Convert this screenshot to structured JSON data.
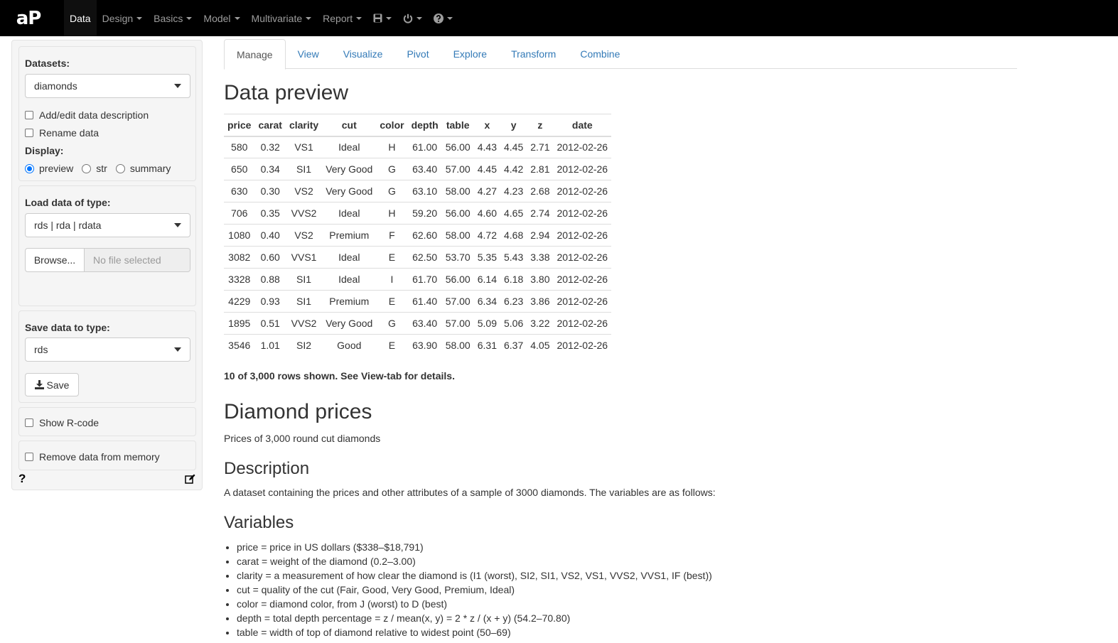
{
  "brand": "aP",
  "navbar": {
    "items": [
      {
        "label": "Data",
        "active": true,
        "caret": false
      },
      {
        "label": "Design",
        "active": false,
        "caret": true
      },
      {
        "label": "Basics",
        "active": false,
        "caret": true
      },
      {
        "label": "Model",
        "active": false,
        "caret": true
      },
      {
        "label": "Multivariate",
        "active": false,
        "caret": true
      },
      {
        "label": "Report",
        "active": false,
        "caret": true
      }
    ],
    "icons": [
      "save-icon",
      "power-icon",
      "help-icon"
    ]
  },
  "sidebar": {
    "datasets_label": "Datasets:",
    "datasets_value": "diamonds",
    "add_edit_label": "Add/edit data description",
    "rename_label": "Rename data",
    "display_label": "Display:",
    "display_options": [
      "preview",
      "str",
      "summary"
    ],
    "display_selected": "preview",
    "load_label": "Load data of type:",
    "load_value": "rds | rda | rdata",
    "browse_label": "Browse...",
    "file_placeholder": "No file selected",
    "save_type_label": "Save data to type:",
    "save_type_value": "rds",
    "save_button": "Save",
    "show_rcode_label": "Show R-code",
    "remove_data_label": "Remove data from memory",
    "help_symbol": "?"
  },
  "tabs": [
    "Manage",
    "View",
    "Visualize",
    "Pivot",
    "Explore",
    "Transform",
    "Combine"
  ],
  "active_tab": "Manage",
  "preview": {
    "title": "Data preview",
    "columns": [
      "price",
      "carat",
      "clarity",
      "cut",
      "color",
      "depth",
      "table",
      "x",
      "y",
      "z",
      "date"
    ],
    "rows": [
      [
        "580",
        "0.32",
        "VS1",
        "Ideal",
        "H",
        "61.00",
        "56.00",
        "4.43",
        "4.45",
        "2.71",
        "2012-02-26"
      ],
      [
        "650",
        "0.34",
        "SI1",
        "Very Good",
        "G",
        "63.40",
        "57.00",
        "4.45",
        "4.42",
        "2.81",
        "2012-02-26"
      ],
      [
        "630",
        "0.30",
        "VS2",
        "Very Good",
        "G",
        "63.10",
        "58.00",
        "4.27",
        "4.23",
        "2.68",
        "2012-02-26"
      ],
      [
        "706",
        "0.35",
        "VVS2",
        "Ideal",
        "H",
        "59.20",
        "56.00",
        "4.60",
        "4.65",
        "2.74",
        "2012-02-26"
      ],
      [
        "1080",
        "0.40",
        "VS2",
        "Premium",
        "F",
        "62.60",
        "58.00",
        "4.72",
        "4.68",
        "2.94",
        "2012-02-26"
      ],
      [
        "3082",
        "0.60",
        "VVS1",
        "Ideal",
        "E",
        "62.50",
        "53.70",
        "5.35",
        "5.43",
        "3.38",
        "2012-02-26"
      ],
      [
        "3328",
        "0.88",
        "SI1",
        "Ideal",
        "I",
        "61.70",
        "56.00",
        "6.14",
        "6.18",
        "3.80",
        "2012-02-26"
      ],
      [
        "4229",
        "0.93",
        "SI1",
        "Premium",
        "E",
        "61.40",
        "57.00",
        "6.34",
        "6.23",
        "3.86",
        "2012-02-26"
      ],
      [
        "1895",
        "0.51",
        "VVS2",
        "Very Good",
        "G",
        "63.40",
        "57.00",
        "5.09",
        "5.06",
        "3.22",
        "2012-02-26"
      ],
      [
        "3546",
        "1.01",
        "SI2",
        "Good",
        "E",
        "63.90",
        "58.00",
        "6.31",
        "6.37",
        "4.05",
        "2012-02-26"
      ]
    ],
    "note": "10 of 3,000 rows shown. See View-tab for details."
  },
  "description": {
    "heading": "Diamond prices",
    "subtitle": "Prices of 3,000 round cut diamonds",
    "desc_heading": "Description",
    "desc_text": "A dataset containing the prices and other attributes of a sample of 3000 diamonds. The variables are as follows:",
    "vars_heading": "Variables",
    "variables": [
      "price = price in US dollars ($338–$18,791)",
      "carat = weight of the diamond (0.2–3.00)",
      "clarity = a measurement of how clear the diamond is (I1 (worst), SI2, SI1, VS2, VS1, VVS2, VVS1, IF (best))",
      "cut = quality of the cut (Fair, Good, Very Good, Premium, Ideal)",
      "color = diamond color, from J (worst) to D (best)",
      "depth = total depth percentage = z / mean(x, y) = 2 * z / (x + y) (54.2–70.80)",
      "table = width of top of diamond relative to widest point (50–69)"
    ]
  },
  "colors": {
    "navbar": "#000000",
    "link": "#337ab7",
    "radio_checked": "#0075ff"
  }
}
